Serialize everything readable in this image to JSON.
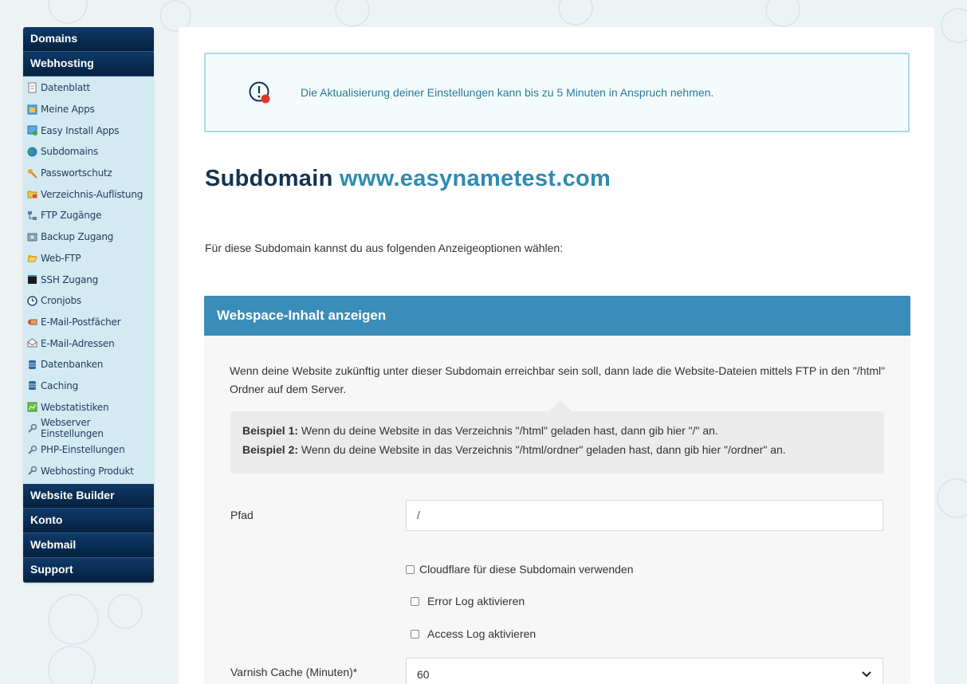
{
  "sidebar": {
    "sections_top": [
      "Domains",
      "Webhosting"
    ],
    "items": [
      {
        "label": "Datenblatt",
        "icon": "document-icon"
      },
      {
        "label": "Meine Apps",
        "icon": "apps-icon"
      },
      {
        "label": "Easy Install Apps",
        "icon": "install-icon"
      },
      {
        "label": "Subdomains",
        "icon": "globe-icon"
      },
      {
        "label": "Passwortschutz",
        "icon": "key-icon"
      },
      {
        "label": "Verzeichnis-Auflistung",
        "icon": "folder-icon"
      },
      {
        "label": "FTP Zugänge",
        "icon": "network-icon"
      },
      {
        "label": "Backup Zugang",
        "icon": "backup-icon"
      },
      {
        "label": "Web-FTP",
        "icon": "open-folder-icon"
      },
      {
        "label": "SSH Zugang",
        "icon": "terminal-icon"
      },
      {
        "label": "Cronjobs",
        "icon": "clock-icon"
      },
      {
        "label": "E-Mail-Postfächer",
        "icon": "mailbox-icon"
      },
      {
        "label": "E-Mail-Adressen",
        "icon": "envelope-icon"
      },
      {
        "label": "Datenbanken",
        "icon": "database-icon"
      },
      {
        "label": "Caching",
        "icon": "cache-icon"
      },
      {
        "label": "Webstatistiken",
        "icon": "chart-icon"
      },
      {
        "label": "Webserver Einstellungen",
        "icon": "wrench-icon"
      },
      {
        "label": "PHP-Einstellungen",
        "icon": "wrench-icon"
      },
      {
        "label": "Webhosting Produkt",
        "icon": "wrench-icon"
      }
    ],
    "sections_bottom": [
      "Website Builder",
      "Konto",
      "Webmail",
      "Support"
    ]
  },
  "notice": {
    "text": "Die Aktualisierung deiner Einstellungen kann bis zu 5 Minuten in Anspruch nehmen.",
    "icon": "alert-icon"
  },
  "page": {
    "title_prefix": "Subdomain",
    "title_domain": "www.easynametest.com",
    "intro": "Für diese Subdomain kannst du aus folgenden Anzeigeoptionen wählen:"
  },
  "card": {
    "header": "Webspace-Inhalt anzeigen",
    "description": "Wenn deine Website zukünftig unter dieser Subdomain erreichbar sein soll, dann lade die Website-Dateien mittels FTP in den \"/html\" Ordner auf dem Server.",
    "examples": [
      {
        "label": "Beispiel 1:",
        "text": " Wenn du deine Website in das Verzeichnis \"/html\" geladen hast, dann gib hier \"/\" an."
      },
      {
        "label": "Beispiel 2:",
        "text": " Wenn du deine Website in das Verzeichnis \"/html/ordner\" geladen hast, dann gib hier \"/ordner\" an."
      }
    ],
    "path_label": "Pfad",
    "path_value": "/",
    "checkboxes": [
      {
        "label": "Cloudflare für diese Subdomain verwenden",
        "checked": false
      },
      {
        "label": "Error Log aktivieren",
        "checked": false
      },
      {
        "label": "Access Log aktivieren",
        "checked": false
      }
    ],
    "varnish_label": "Varnish Cache (Minuten)*",
    "varnish_value": "60"
  },
  "colors": {
    "sidebar_dark": "#0f3a69",
    "sidebar_light": "#d3eaf3",
    "accent": "#3a8db8",
    "title": "#14334f",
    "domain": "#2e8bb0",
    "notice_border": "#a9dce4"
  }
}
